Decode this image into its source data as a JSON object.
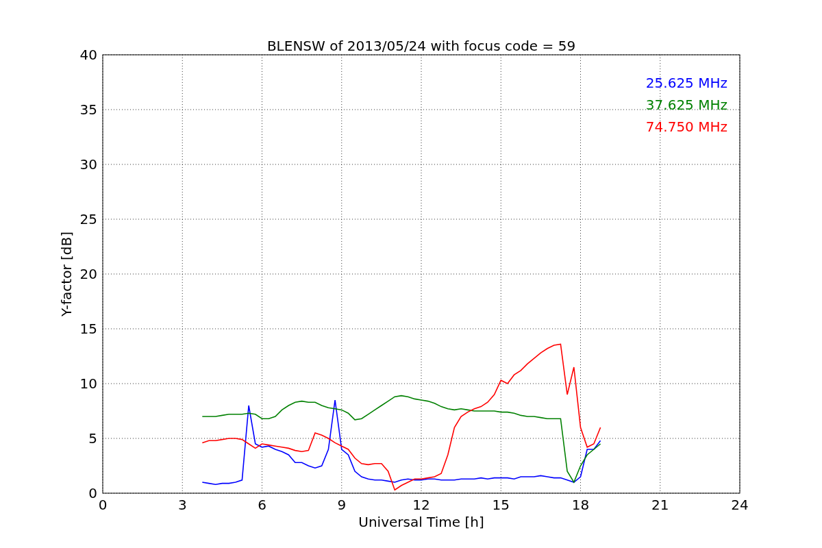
{
  "chart_data": {
    "type": "line",
    "title": "BLENSW of 2013/05/24 with focus code = 59",
    "xlabel": "Universal Time [h]",
    "ylabel": "Y-factor [dB]",
    "x": [
      3.75,
      4,
      4.25,
      4.5,
      4.75,
      5,
      5.25,
      5.5,
      5.75,
      6,
      6.25,
      6.5,
      6.75,
      7,
      7.25,
      7.5,
      7.75,
      8,
      8.25,
      8.5,
      8.75,
      9,
      9.25,
      9.5,
      9.75,
      10,
      10.25,
      10.5,
      10.75,
      11,
      11.25,
      11.5,
      11.75,
      12,
      12.25,
      12.5,
      12.75,
      13,
      13.25,
      13.5,
      13.75,
      14,
      14.25,
      14.5,
      14.75,
      15,
      15.25,
      15.5,
      15.75,
      16,
      16.25,
      16.5,
      16.75,
      17,
      17.25,
      17.5,
      17.75,
      18,
      18.25,
      18.5,
      18.75
    ],
    "series": [
      {
        "name": "25.625 MHz",
        "color": "#0000ff",
        "values": [
          1,
          0.9,
          0.8,
          0.9,
          0.9,
          1,
          1.2,
          8,
          4.5,
          4.2,
          4.3,
          4,
          3.8,
          3.5,
          2.8,
          2.8,
          2.5,
          2.3,
          2.5,
          4,
          8.5,
          4,
          3.5,
          2,
          1.5,
          1.3,
          1.2,
          1.2,
          1.1,
          1,
          1.2,
          1.3,
          1.2,
          1.2,
          1.3,
          1.3,
          1.2,
          1.2,
          1.2,
          1.3,
          1.3,
          1.3,
          1.4,
          1.3,
          1.4,
          1.4,
          1.4,
          1.3,
          1.5,
          1.5,
          1.5,
          1.6,
          1.5,
          1.4,
          1.4,
          1.2,
          1,
          1.5,
          4,
          4,
          4.8
        ]
      },
      {
        "name": "37.625 MHz",
        "color": "#008000",
        "values": [
          7,
          7,
          7,
          7.1,
          7.2,
          7.2,
          7.2,
          7.3,
          7.2,
          6.8,
          6.8,
          7,
          7.6,
          8,
          8.3,
          8.4,
          8.3,
          8.3,
          8,
          7.8,
          7.7,
          7.6,
          7.3,
          6.7,
          6.8,
          7.2,
          7.6,
          8,
          8.4,
          8.8,
          8.9,
          8.8,
          8.6,
          8.5,
          8.4,
          8.2,
          7.9,
          7.7,
          7.6,
          7.7,
          7.6,
          7.5,
          7.5,
          7.5,
          7.5,
          7.4,
          7.4,
          7.3,
          7.1,
          7,
          7,
          6.9,
          6.8,
          6.8,
          6.8,
          2,
          1,
          2.5,
          3.5,
          4,
          4.5
        ]
      },
      {
        "name": "74.750 MHz",
        "color": "#ff0000",
        "values": [
          4.6,
          4.8,
          4.8,
          4.9,
          5,
          5,
          4.9,
          4.5,
          4.1,
          4.5,
          4.4,
          4.3,
          4.2,
          4.1,
          3.9,
          3.8,
          3.9,
          5.5,
          5.3,
          5,
          4.6,
          4.3,
          4,
          3.2,
          2.7,
          2.6,
          2.7,
          2.7,
          2,
          0.3,
          0.7,
          1,
          1.3,
          1.3,
          1.4,
          1.5,
          1.8,
          3.5,
          6,
          7,
          7.4,
          7.7,
          7.9,
          8.3,
          9,
          10.3,
          10,
          10.8,
          11.2,
          11.8,
          12.3,
          12.8,
          13.2,
          13.5,
          13.6,
          9,
          11.5,
          6,
          4.2,
          4.5,
          6
        ]
      }
    ],
    "xlim": [
      0,
      24
    ],
    "ylim": [
      0,
      40
    ],
    "xticks": [
      0,
      3,
      6,
      9,
      12,
      15,
      18,
      21,
      24
    ],
    "yticks": [
      0,
      5,
      10,
      15,
      20,
      25,
      30,
      35,
      40
    ],
    "grid": true
  }
}
